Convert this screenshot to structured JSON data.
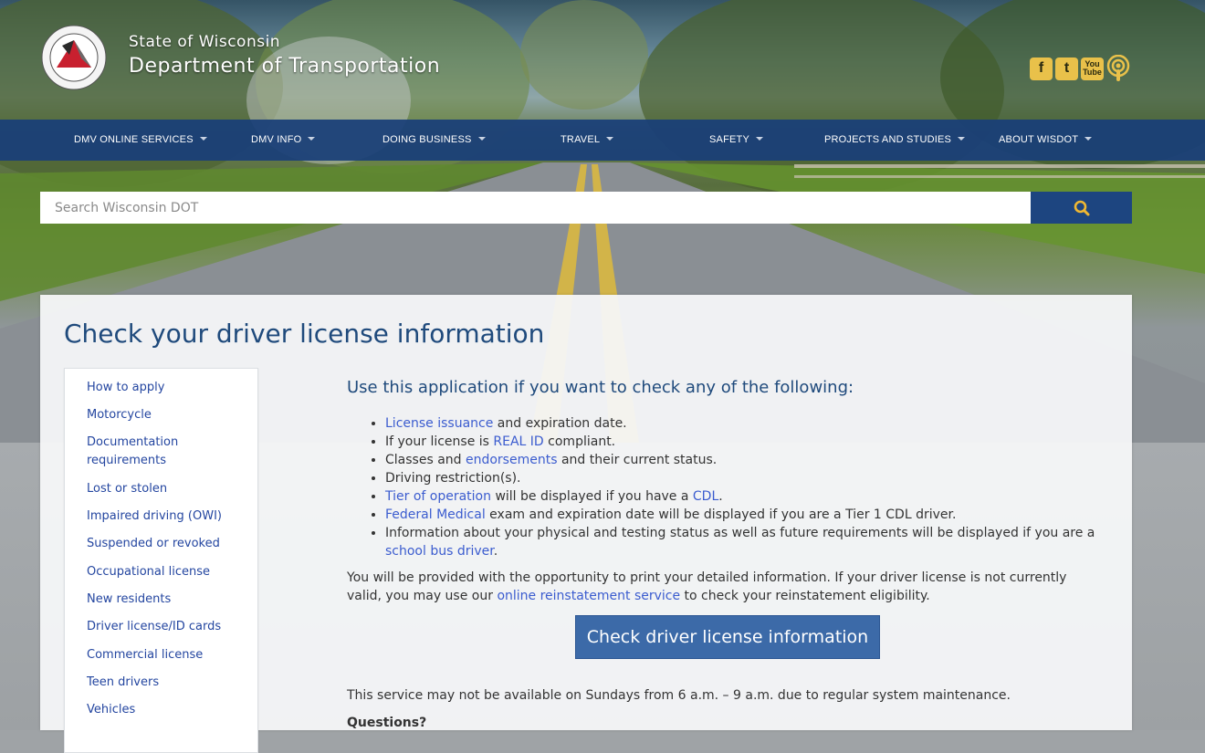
{
  "header": {
    "state_name": "State of Wisconsin",
    "department": "Department of Transportation",
    "social": [
      {
        "name": "facebook-icon",
        "glyph": "f"
      },
      {
        "name": "twitter-icon",
        "glyph": "t"
      },
      {
        "name": "youtube-icon",
        "glyph": "You Tube"
      },
      {
        "name": "podcast-icon",
        "glyph": ""
      }
    ]
  },
  "nav": [
    {
      "label": "DMV ONLINE SERVICES"
    },
    {
      "label": "DMV INFO"
    },
    {
      "label": "DOING BUSINESS"
    },
    {
      "label": "TRAVEL"
    },
    {
      "label": "SAFETY"
    },
    {
      "label": "PROJECTS AND STUDIES"
    },
    {
      "label": "ABOUT WISDOT"
    }
  ],
  "search": {
    "placeholder": "Search Wisconsin DOT"
  },
  "page": {
    "title": "Check your driver license information",
    "lead": "Use this application if you want to check any of the following:",
    "bullets": [
      {
        "link": "License issuance",
        "text": " and expiration date."
      },
      {
        "pre": "If your license is ",
        "link": "REAL ID",
        "text": " compliant."
      },
      {
        "pre": "Classes and ",
        "link": "endorsements",
        "text": " and their current status."
      },
      {
        "text": "Driving restriction(s)."
      },
      {
        "link": "Tier of operation",
        "text": " will be displayed if you have a ",
        "link2": "CDL",
        "text2": "."
      },
      {
        "link": "Federal Medical",
        "text": " exam and expiration date will be displayed if you are a Tier 1 CDL driver."
      },
      {
        "pre": "Information about your physical and testing status as well as future requirements will be displayed if you are a ",
        "link": "school bus driver",
        "text": "."
      }
    ],
    "paragraph_pre": "You will be provided with the opportunity to print your detailed information. If your driver license is not currently valid, you may use our ",
    "paragraph_link": "online reinstatement service",
    "paragraph_post": " to check your reinstatement eligibility.",
    "cta_label": "Check driver license information",
    "maintenance": "This service may not be available on Sundays from 6 a.m. – 9 a.m. due to regular system maintenance.",
    "questions": "Questions?"
  },
  "sidebar": {
    "items": [
      {
        "label": "How to apply"
      },
      {
        "label": "Motorcycle"
      },
      {
        "label": "Documentation requirements"
      },
      {
        "label": "Lost or stolen"
      },
      {
        "label": "Impaired driving (OWI)"
      },
      {
        "label": "Suspended or revoked"
      },
      {
        "label": "Occupational license"
      },
      {
        "label": "New residents"
      },
      {
        "label": "Driver license/ID cards"
      },
      {
        "label": "Commercial license"
      },
      {
        "label": "Teen drivers"
      },
      {
        "label": "Vehicles"
      }
    ]
  },
  "colors": {
    "nav_bg": "#193e78",
    "title_blue": "#1f4a7c",
    "link_blue": "#3b5ccf",
    "cta_bg": "#3c6aa8",
    "social_gold": "#e9c14a"
  }
}
